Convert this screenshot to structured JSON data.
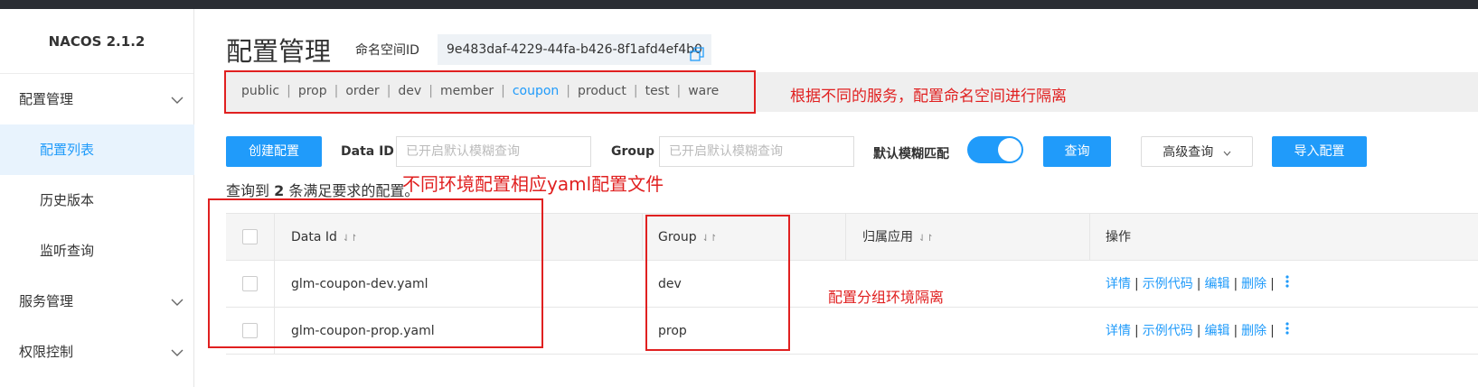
{
  "app": {
    "brand": "NACOS 2.1.2"
  },
  "sidebar": {
    "items": [
      {
        "label": "配置管理",
        "level": 1,
        "expandable": true
      },
      {
        "label": "配置列表",
        "level": 2,
        "active": true
      },
      {
        "label": "历史版本",
        "level": 2
      },
      {
        "label": "监听查询",
        "level": 2
      },
      {
        "label": "服务管理",
        "level": 1,
        "expandable": true
      },
      {
        "label": "权限控制",
        "level": 1,
        "expandable": true
      }
    ]
  },
  "header": {
    "title": "配置管理",
    "namespace_label": "命名空间ID",
    "namespace_id": "9e483daf-4229-44fa-b426-8f1afd4ef4b0"
  },
  "namespaces": {
    "items": [
      "public",
      "prop",
      "order",
      "dev",
      "member",
      "coupon",
      "product",
      "test",
      "ware"
    ],
    "active": "coupon"
  },
  "filters": {
    "create_button": "创建配置",
    "data_id_label": "Data ID",
    "data_id_placeholder": "已开启默认模糊查询",
    "group_label": "Group",
    "group_placeholder": "已开启默认模糊查询",
    "fuzzy_label": "默认模糊匹配",
    "fuzzy_enabled": true,
    "query_button": "查询",
    "advanced_button": "高级查询",
    "import_button": "导入配置"
  },
  "result": {
    "prefix": "查询到",
    "count": "2",
    "suffix": "条满足要求的配置。"
  },
  "table": {
    "columns": [
      "Data Id",
      "Group",
      "归属应用",
      "操作"
    ],
    "rows": [
      {
        "data_id": "glm-coupon-dev.yaml",
        "group": "dev",
        "app": ""
      },
      {
        "data_id": "glm-coupon-prop.yaml",
        "group": "prop",
        "app": ""
      }
    ],
    "ops": [
      "详情",
      "示例代码",
      "编辑",
      "删除"
    ]
  },
  "annotations": {
    "namespace_note": "根据不同的服务，配置命名空间进行隔离",
    "env_note": "不同环境配置相应yaml配置文件",
    "group_note": "配置分组环境隔离"
  },
  "colors": {
    "accent": "#209bfa",
    "annotation": "#e02020",
    "topbar": "#2a2d33"
  }
}
